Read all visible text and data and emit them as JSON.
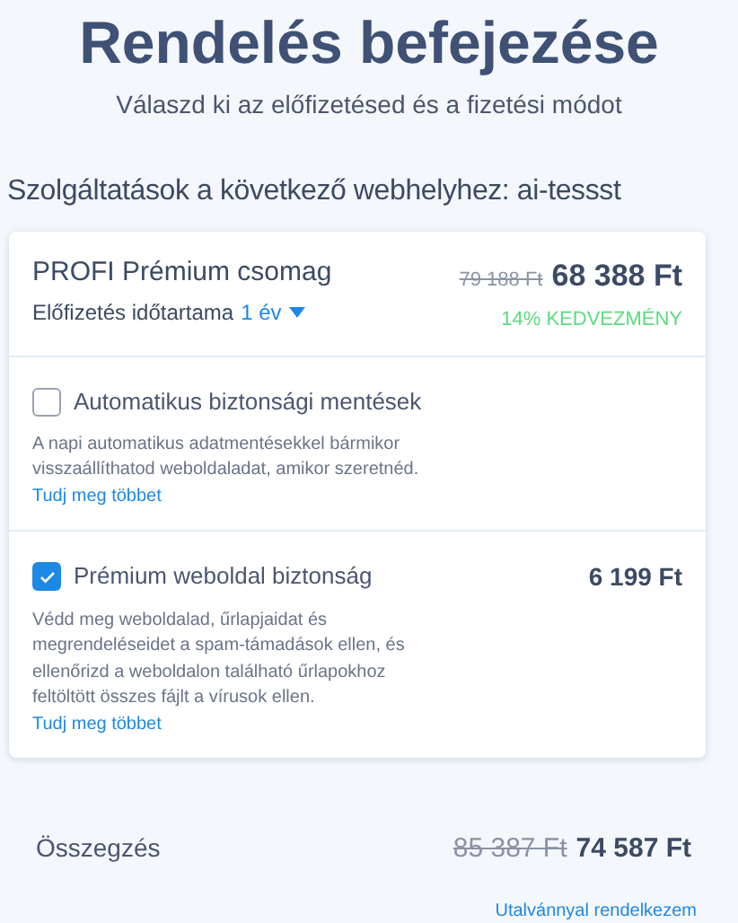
{
  "title": "Rendelés befejezése",
  "subtitle": "Válaszd ki az előfizetésed és a fizetési módot",
  "section_title": "Szolgáltatások a következő webhelyhez: ai-tessst",
  "package": {
    "name": "PROFI Prémium csomag",
    "old_price": "79 188 Ft",
    "price": "68 388 Ft",
    "duration_label": "Előfizetés időtartama",
    "duration": "1 év",
    "discount": "14% KEDVEZMÉNY"
  },
  "addons": [
    {
      "label": "Automatikus biztonsági mentések",
      "checked": false,
      "description": "A napi automatikus adatmentésekkel bármikor visszaállíthatod weboldaladat, amikor szeretnéd.",
      "link": "Tudj meg többet"
    },
    {
      "label": "Prémium weboldal biztonság",
      "checked": true,
      "price": "6 199 Ft",
      "description": "Védd meg weboldalad, űrlapjaidat és megrendeléseidet a spam-támadások ellen, és ellenőrizd a weboldalon található űrlapokhoz feltöltött összes fájlt a vírusok ellen.",
      "link": "Tudj meg többet"
    }
  ],
  "summary": {
    "label": "Összegzés",
    "old_price": "85 387 Ft",
    "price": "74 587 Ft",
    "voucher_link": "Utalvánnyal rendelkezem"
  }
}
